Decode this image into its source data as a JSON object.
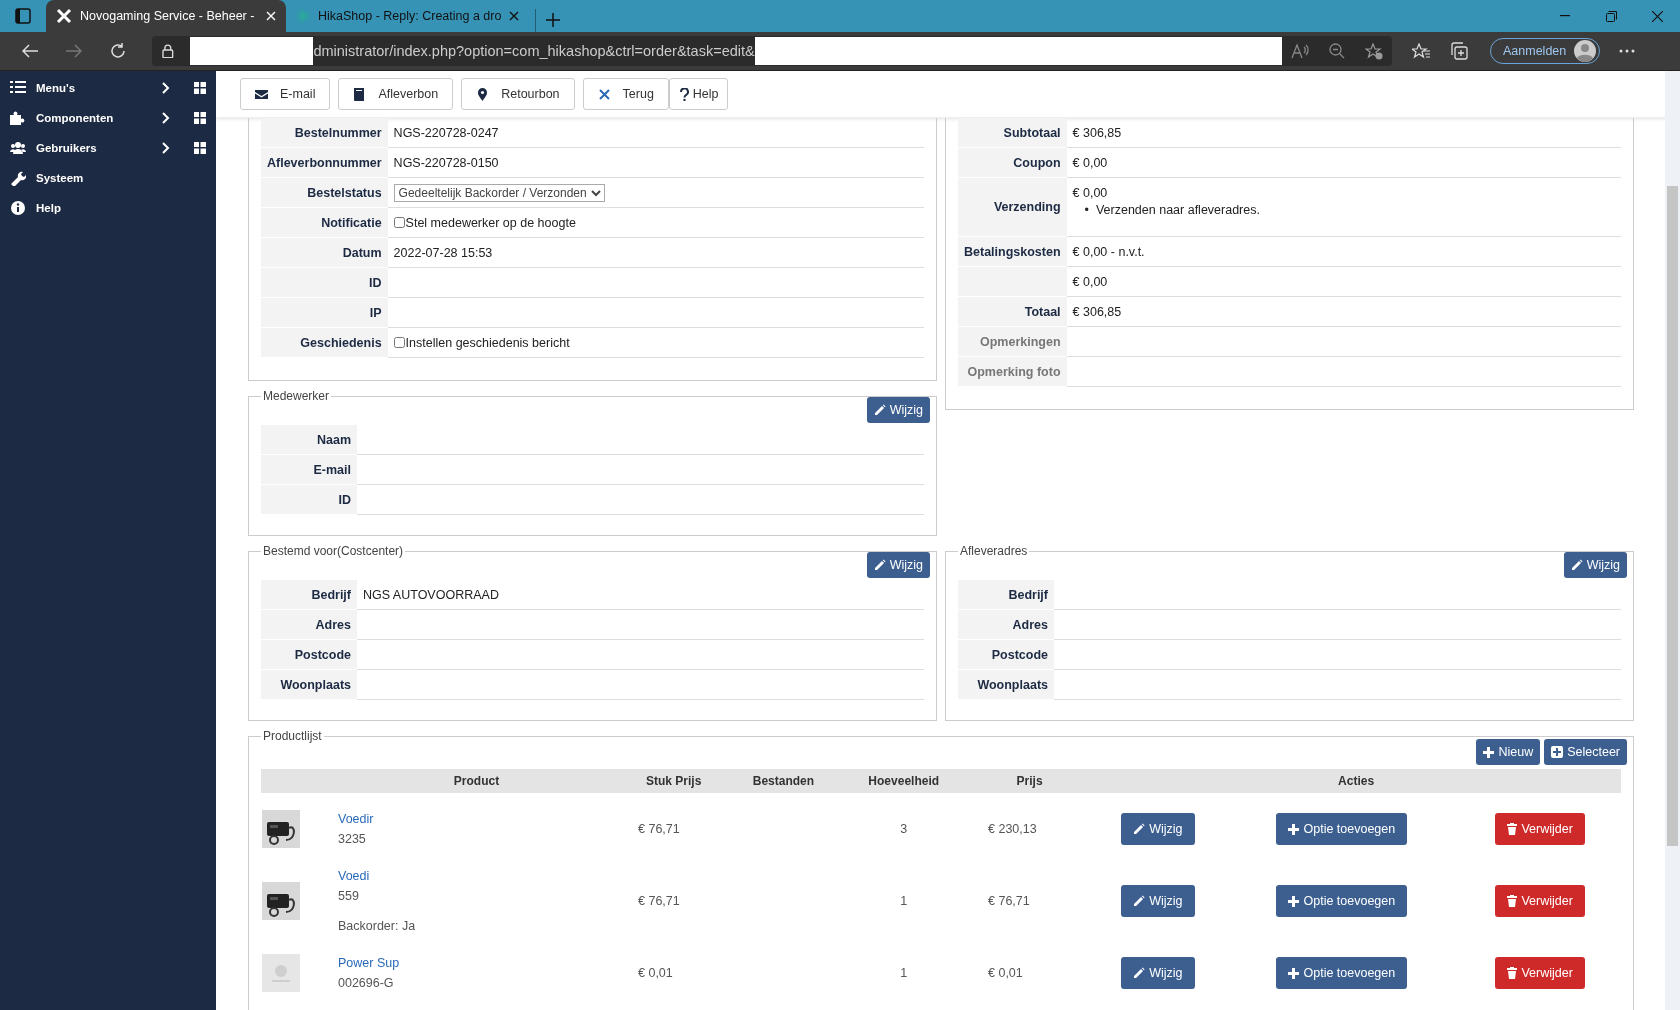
{
  "browser": {
    "tabs": [
      {
        "title": "Novogaming Service - Beheer -",
        "selected": true
      },
      {
        "title": "HikaShop - Reply: Creating a dro",
        "selected": false
      }
    ],
    "url": "dministrator/index.php?option=com_hikashop&ctrl=order&task=edit&",
    "signin": "Aanmelden"
  },
  "sidebar": {
    "items": [
      {
        "label": "Menu's",
        "expandable": true
      },
      {
        "label": "Componenten",
        "expandable": true
      },
      {
        "label": "Gebruikers",
        "expandable": true
      },
      {
        "label": "Systeem",
        "expandable": false
      },
      {
        "label": "Help",
        "expandable": false
      }
    ]
  },
  "toolbar": [
    "E-mail",
    "Afleverbon",
    "Retourbon",
    "Terug",
    "Help"
  ],
  "order": {
    "rows": [
      {
        "label": "Bestelnummer",
        "kind": "text",
        "value": "NGS-220728-0247"
      },
      {
        "label": "Afleverbonnummer",
        "kind": "text",
        "value": "NGS-220728-0150"
      },
      {
        "label": "Bestelstatus",
        "kind": "select",
        "value": "Gedeeltelijk Backorder / Verzonden"
      },
      {
        "label": "Notificatie",
        "kind": "checkbox",
        "value": "Stel medewerker op de hoogte",
        "checked": false
      },
      {
        "label": "Datum",
        "kind": "text",
        "value": "2022-07-28 15:53"
      },
      {
        "label": "ID",
        "kind": "text"
      },
      {
        "label": "IP",
        "kind": "text"
      },
      {
        "label": "Geschiedenis",
        "kind": "checkbox",
        "value": "Instellen geschiedenis bericht",
        "checked": false
      }
    ]
  },
  "totals": {
    "rows": [
      {
        "label": "Subtotaal",
        "value": "€ 306,85",
        "dimmed": false
      },
      {
        "label": "Coupon",
        "value": "€ 0,00",
        "dimmed": false
      },
      {
        "label": "Verzending",
        "value": "€ 0,00",
        "note_marker": "•",
        "note": "Verzenden naar afleveradres.",
        "dimmed": false
      },
      {
        "label": "Betalingskosten",
        "value": "€ 0,00 - n.v.t.",
        "dimmed": false
      },
      {
        "value": "€ 0,00"
      },
      {
        "label": "Totaal",
        "value": "€ 306,85",
        "dimmed": false
      },
      {
        "label": "Opmerkingen",
        "dimmed": true
      },
      {
        "label": "Opmerking foto",
        "dimmed": true
      }
    ]
  },
  "employee": {
    "legend": "Medewerker",
    "button": "Wijzig",
    "rows": [
      {
        "label": "Naam"
      },
      {
        "label": "E-mail"
      },
      {
        "label": "ID"
      }
    ]
  },
  "costcenter": {
    "legend": "Bestemd voor(Costcenter)",
    "button": "Wijzig",
    "rows": [
      {
        "label": "Bedrijf",
        "value": "NGS AUTOVOORRAAD"
      },
      {
        "label": "Adres"
      },
      {
        "label": "Postcode"
      },
      {
        "label": "Woonplaats"
      }
    ]
  },
  "delivery": {
    "legend": "Afleveradres",
    "button": "Wijzig",
    "rows": [
      {
        "label": "Bedrijf"
      },
      {
        "label": "Adres"
      },
      {
        "label": "Postcode"
      },
      {
        "label": "Woonplaats"
      }
    ]
  },
  "products": {
    "legend": "Productlijst",
    "buttons": [
      "Nieuw",
      "Selecteer"
    ],
    "columns": [
      "Product",
      "Stuk Prijs",
      "Bestanden",
      "Hoeveelheid",
      "Prijs",
      "Acties"
    ],
    "rows": [
      {
        "name": "Voedir",
        "code": "3235",
        "unit_price": "€ 76,71",
        "quantity": "3",
        "price": "€ 230,13",
        "actions": [
          "Wijzig",
          "Optie toevoegen",
          "Verwijder"
        ]
      },
      {
        "name": "Voedi",
        "code": "559",
        "backorder": "Backorder: Ja",
        "unit_price": "€ 76,71",
        "quantity": "1",
        "price": "€ 76,71",
        "actions": [
          "Wijzig",
          "Optie toevoegen",
          "Verwijder"
        ]
      },
      {
        "name": "Power Sup",
        "code": "002696-G",
        "unit_price": "€ 0,01",
        "quantity": "1",
        "price": "€ 0,01",
        "actions": [
          "Wijzig",
          "Optie toevoegen",
          "Verwijder"
        ]
      }
    ]
  }
}
